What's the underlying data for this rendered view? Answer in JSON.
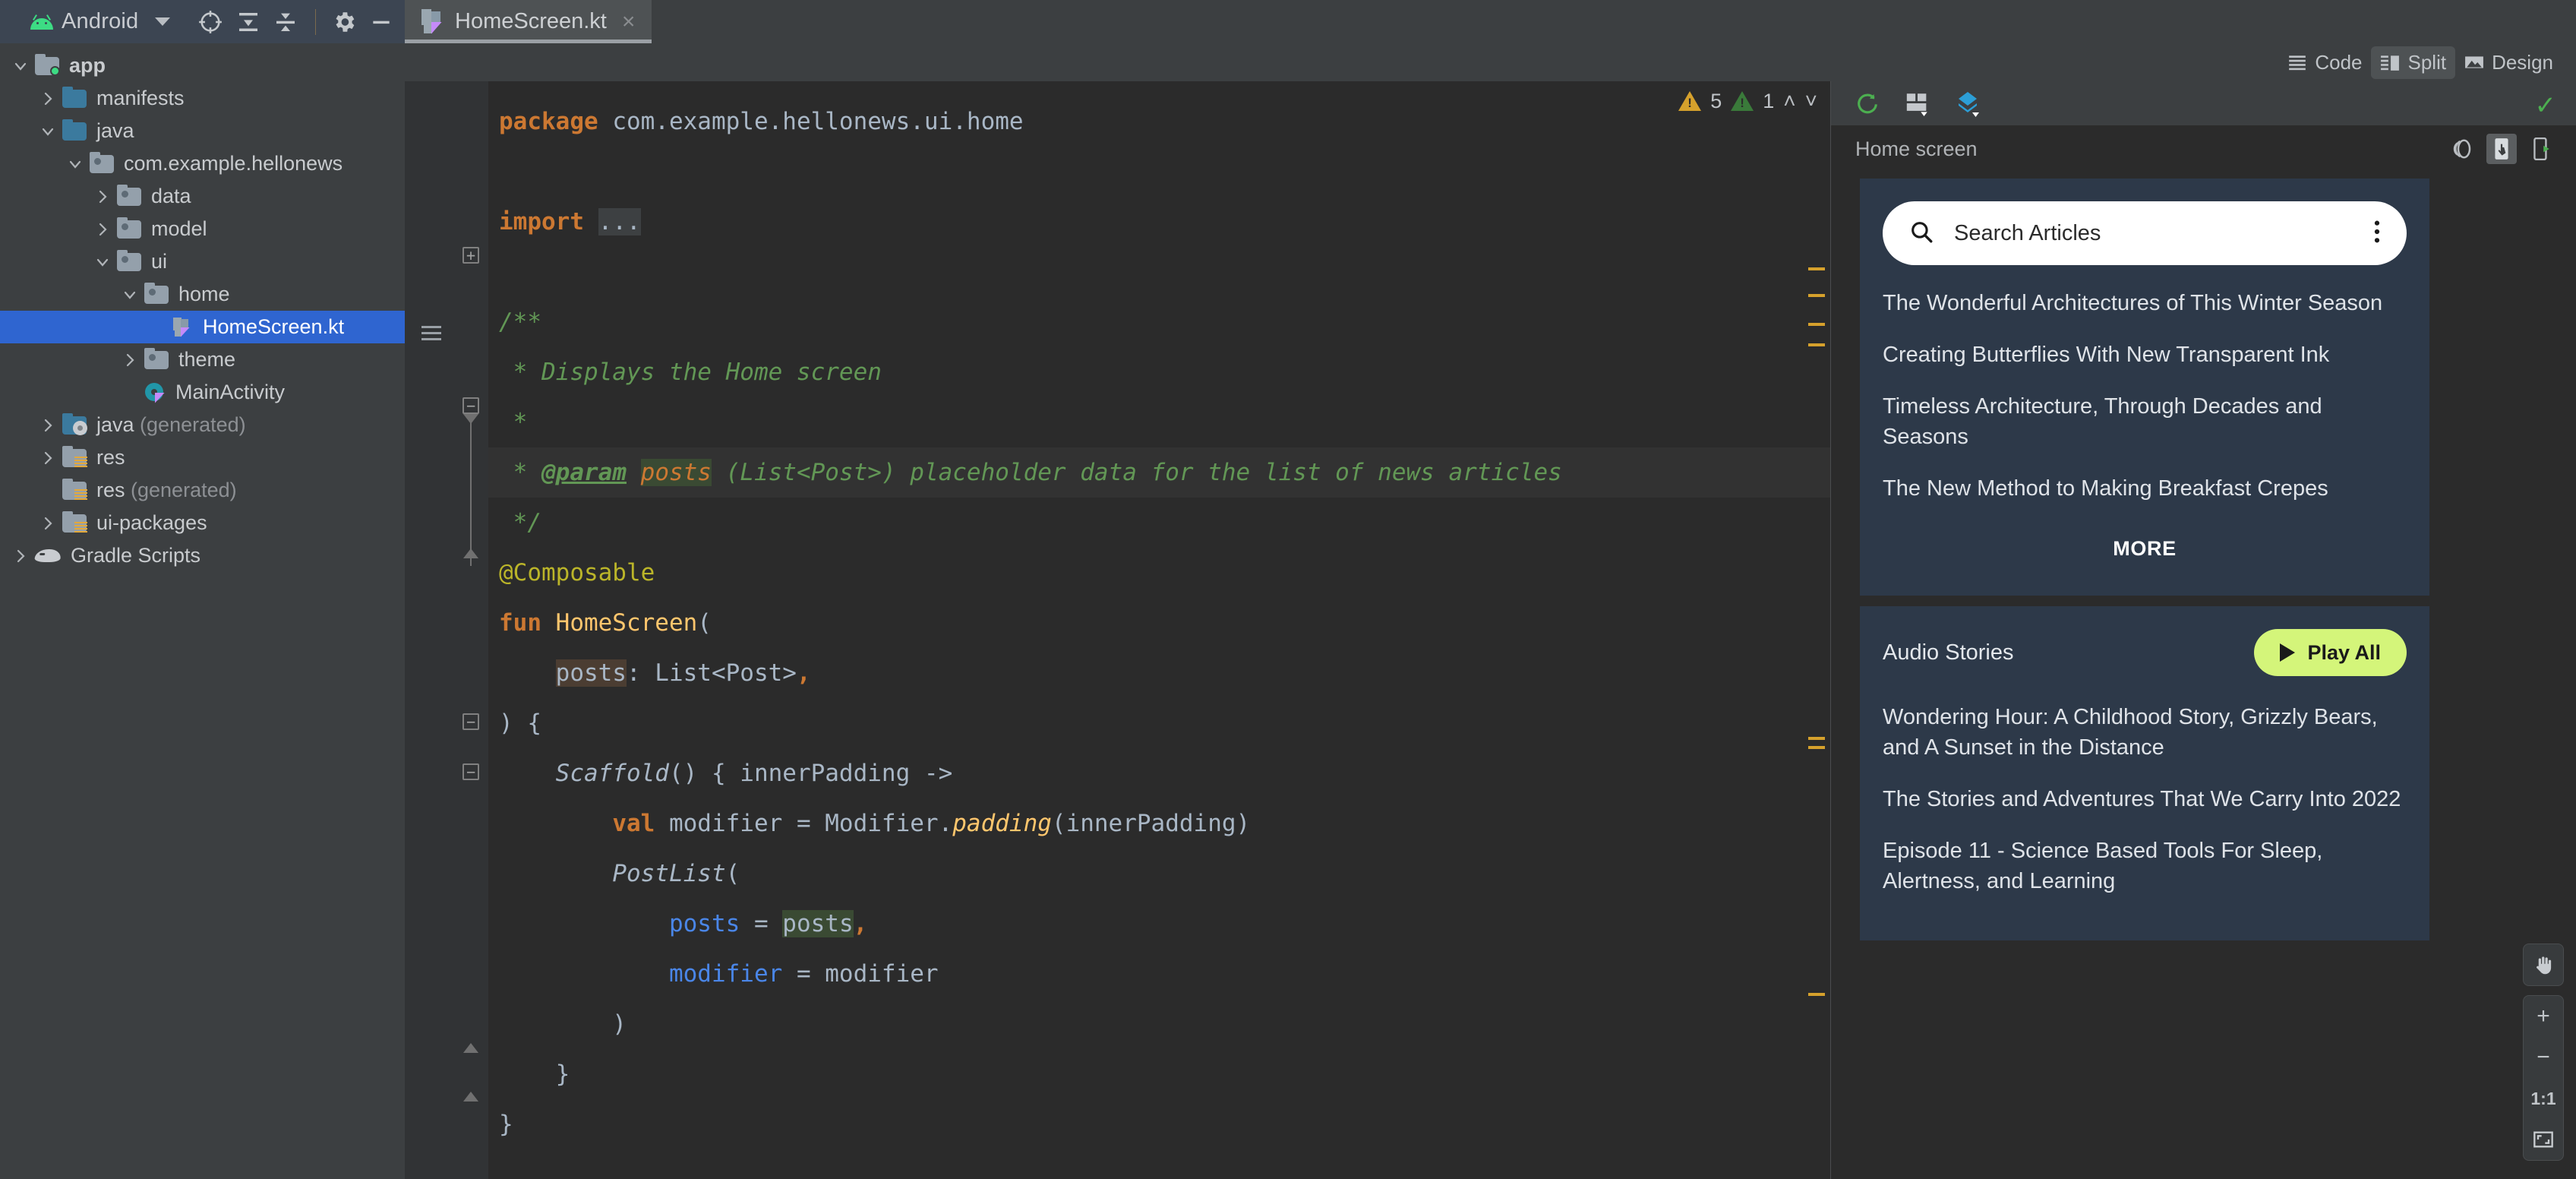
{
  "window": {
    "app_selector_label": "Android",
    "toolbar_icons": [
      "target-icon",
      "collapse-all-icon",
      "expand-all-icon",
      "settings-gear-icon",
      "minimize-icon"
    ]
  },
  "tab": {
    "title": "HomeScreen.kt",
    "close_label": "×",
    "file_icon": "kotlin-file-icon"
  },
  "editor_modes": {
    "code": "Code",
    "split": "Split",
    "design": "Design",
    "active": "Split"
  },
  "project_tree": {
    "items": [
      {
        "label": "app",
        "indent": 0,
        "arrow": "down",
        "icon": "module-folder-icon",
        "bold": true,
        "selected": false,
        "muted": ""
      },
      {
        "label": "manifests",
        "indent": 1,
        "arrow": "right",
        "icon": "folder-blue-icon",
        "bold": false,
        "selected": false,
        "muted": ""
      },
      {
        "label": "java",
        "indent": 1,
        "arrow": "down",
        "icon": "folder-blue-icon",
        "bold": false,
        "selected": false,
        "muted": ""
      },
      {
        "label": "com.example.hellonews",
        "indent": 2,
        "arrow": "down",
        "icon": "package-folder-icon",
        "bold": false,
        "selected": false,
        "muted": ""
      },
      {
        "label": "data",
        "indent": 3,
        "arrow": "right",
        "icon": "package-folder-icon",
        "bold": false,
        "selected": false,
        "muted": ""
      },
      {
        "label": "model",
        "indent": 3,
        "arrow": "right",
        "icon": "package-folder-icon",
        "bold": false,
        "selected": false,
        "muted": ""
      },
      {
        "label": "ui",
        "indent": 3,
        "arrow": "down",
        "icon": "package-folder-icon",
        "bold": false,
        "selected": false,
        "muted": ""
      },
      {
        "label": "home",
        "indent": 4,
        "arrow": "down",
        "icon": "package-folder-icon",
        "bold": false,
        "selected": false,
        "muted": ""
      },
      {
        "label": "HomeScreen.kt",
        "indent": 5,
        "arrow": "none",
        "icon": "kotlin-file-icon",
        "bold": false,
        "selected": true,
        "muted": ""
      },
      {
        "label": "theme",
        "indent": 4,
        "arrow": "right",
        "icon": "package-folder-icon",
        "bold": false,
        "selected": false,
        "muted": ""
      },
      {
        "label": "MainActivity",
        "indent": 4,
        "arrow": "none",
        "icon": "kotlin-activity-icon",
        "bold": false,
        "selected": false,
        "muted": ""
      },
      {
        "label": "java",
        "indent": 1,
        "arrow": "right",
        "icon": "folder-generated-icon",
        "bold": false,
        "selected": false,
        "muted": "(generated)"
      },
      {
        "label": "res",
        "indent": 1,
        "arrow": "right",
        "icon": "folder-res-icon",
        "bold": false,
        "selected": false,
        "muted": ""
      },
      {
        "label": "res",
        "indent": 1,
        "arrow": "none",
        "icon": "folder-res-icon",
        "bold": false,
        "selected": false,
        "muted": "(generated)"
      },
      {
        "label": "ui-packages",
        "indent": 1,
        "arrow": "right",
        "icon": "folder-res-icon",
        "bold": false,
        "selected": false,
        "muted": ""
      },
      {
        "label": "Gradle Scripts",
        "indent": 0,
        "arrow": "right",
        "icon": "gradle-elephant-icon",
        "bold": false,
        "selected": false,
        "muted": ""
      }
    ]
  },
  "inspections": {
    "warning_count": "5",
    "weak_warning_count": "1",
    "prev_label": "˄",
    "next_label": "˅"
  },
  "code": {
    "lines": [
      {
        "segments": [
          {
            "t": "package ",
            "c": "t-kw"
          },
          {
            "t": "com.example.hellonews.ui.home",
            "c": "t-def"
          }
        ]
      },
      {
        "segments": []
      },
      {
        "segments": [
          {
            "t": "import ",
            "c": "t-kw"
          },
          {
            "t": "...",
            "c": "t-def hl-grey"
          }
        ]
      },
      {
        "segments": []
      },
      {
        "segments": [
          {
            "t": "/**",
            "c": "t-com"
          }
        ]
      },
      {
        "segments": [
          {
            "t": " * Displays the Home screen",
            "c": "t-com"
          }
        ]
      },
      {
        "segments": [
          {
            "t": " *",
            "c": "t-com"
          }
        ]
      },
      {
        "hl": true,
        "segments": [
          {
            "t": " * ",
            "c": "t-com"
          },
          {
            "t": "@param",
            "c": "t-comtag"
          },
          {
            "t": " ",
            "c": "t-com"
          },
          {
            "t": "posts",
            "c": "t-param hl-green"
          },
          {
            "t": " (List<Post>) placeholder data for the list of news articles",
            "c": "t-com"
          }
        ]
      },
      {
        "segments": [
          {
            "t": " */",
            "c": "t-com"
          }
        ]
      },
      {
        "segments": [
          {
            "t": "@Composable",
            "c": "t-ann"
          }
        ]
      },
      {
        "segments": [
          {
            "t": "fun ",
            "c": "t-kw"
          },
          {
            "t": "HomeScreen",
            "c": "t-fn"
          },
          {
            "t": "(",
            "c": "t-def"
          }
        ]
      },
      {
        "segments": [
          {
            "t": "    ",
            "c": "t-def"
          },
          {
            "t": "posts",
            "c": "t-def hl-brown"
          },
          {
            "t": ": List<Post>",
            "c": "t-def"
          },
          {
            "t": ",",
            "c": "t-kw"
          }
        ]
      },
      {
        "segments": [
          {
            "t": ") {",
            "c": "t-def"
          }
        ]
      },
      {
        "segments": [
          {
            "t": "    ",
            "c": "t-def"
          },
          {
            "t": "Scaffold",
            "c": "t-italic"
          },
          {
            "t": "() { innerPadding ->",
            "c": "t-def"
          }
        ]
      },
      {
        "segments": [
          {
            "t": "        ",
            "c": "t-def"
          },
          {
            "t": "val ",
            "c": "t-kw"
          },
          {
            "t": "modifier = Modifier.",
            "c": "t-def"
          },
          {
            "t": "padding",
            "c": "t-fni"
          },
          {
            "t": "(innerPadding)",
            "c": "t-def"
          }
        ]
      },
      {
        "segments": [
          {
            "t": "        ",
            "c": "t-def"
          },
          {
            "t": "PostList",
            "c": "t-italic"
          },
          {
            "t": "(",
            "c": "t-def"
          }
        ]
      },
      {
        "segments": [
          {
            "t": "            ",
            "c": "t-def"
          },
          {
            "t": "posts",
            "c": "t-named"
          },
          {
            "t": " = ",
            "c": "t-def"
          },
          {
            "t": "posts",
            "c": "t-def hl-green"
          },
          {
            "t": ",",
            "c": "t-kw"
          }
        ]
      },
      {
        "segments": [
          {
            "t": "            ",
            "c": "t-def"
          },
          {
            "t": "modifier",
            "c": "t-named"
          },
          {
            "t": " = modifier",
            "c": "t-def"
          }
        ]
      },
      {
        "segments": [
          {
            "t": "        )",
            "c": "t-def"
          }
        ]
      },
      {
        "segments": [
          {
            "t": "    }",
            "c": "t-def"
          }
        ]
      },
      {
        "segments": [
          {
            "t": "}",
            "c": "t-def"
          }
        ]
      }
    ]
  },
  "preview": {
    "title": "Home screen",
    "toolbar_icons": [
      "refresh-icon",
      "layout-icon",
      "compose-mode-icon"
    ],
    "status_icon": "check-icon",
    "title_icons": [
      "copy-image-icon",
      "interactive-mode-icon",
      "deploy-preview-icon"
    ],
    "device": {
      "search": {
        "placeholder": "Search Articles",
        "search_icon": "search-icon",
        "overflow_icon": "more-vertical-icon"
      },
      "articles": [
        "The Wonderful Architectures of This Winter Season",
        "Creating Butterflies With New Transparent Ink",
        "Timeless Architecture, Through Decades and Seasons",
        "The New Method to Making Breakfast Crepes"
      ],
      "more_label": "MORE",
      "audio": {
        "section_title": "Audio Stories",
        "play_all_label": "Play All",
        "play_icon": "play-triangle-icon",
        "stories": [
          "Wondering Hour: A Childhood Story, Grizzly Bears, and A Sunset in the Distance",
          "The Stories and Adventures That We Carry Into 2022",
          "Episode 11 - Science Based Tools For Sleep, Alertness, and Learning"
        ]
      }
    },
    "controls": {
      "pan_label": "pan-hand-icon",
      "zoom_in_label": "+",
      "zoom_out_label": "−",
      "zoom_actual_label": "1:1",
      "zoom_fit_label": "fit-screen-icon"
    }
  },
  "colors": {
    "accent_selection": "#2f65d0",
    "android_green": "#3ddc84",
    "play_all_bg": "#d4f57a",
    "device_bg": "#2d3949",
    "warning_yellow": "#d6a12c",
    "weak_warning_green": "#3a7a3a"
  }
}
